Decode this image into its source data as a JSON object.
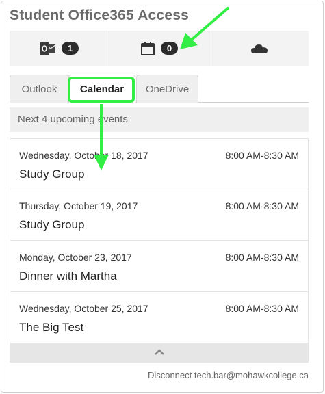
{
  "widget": {
    "title": "Student Office365 Access"
  },
  "stats": [
    {
      "icon": "outlook-icon",
      "count": "1"
    },
    {
      "icon": "calendar-icon",
      "count": "0"
    },
    {
      "icon": "onedrive-cloud-icon",
      "count": ""
    }
  ],
  "tabs": [
    {
      "label": "Outlook",
      "active": false
    },
    {
      "label": "Calendar",
      "active": true
    },
    {
      "label": "OneDrive",
      "active": false
    }
  ],
  "upcoming_label": "Next 4 upcoming events",
  "events": [
    {
      "date": "Wednesday, October 18, 2017",
      "time": "8:00 AM-8:30 AM",
      "title": "Study Group"
    },
    {
      "date": "Thursday, October 19, 2017",
      "time": "8:00 AM-8:30 AM",
      "title": "Study Group"
    },
    {
      "date": "Monday, October 23, 2017",
      "time": "8:00 AM-8:30 AM",
      "title": "Dinner with Martha"
    },
    {
      "date": "Wednesday, October 25, 2017",
      "time": "8:00 AM-8:30 AM",
      "title": "The Big Test"
    }
  ],
  "footer": {
    "disconnect_label": "Disconnect",
    "email": "tech.bar@mohawkcollege.ca"
  },
  "colors": {
    "annotation_green": "#33ee44",
    "badge_bg": "#2b2b2b"
  }
}
